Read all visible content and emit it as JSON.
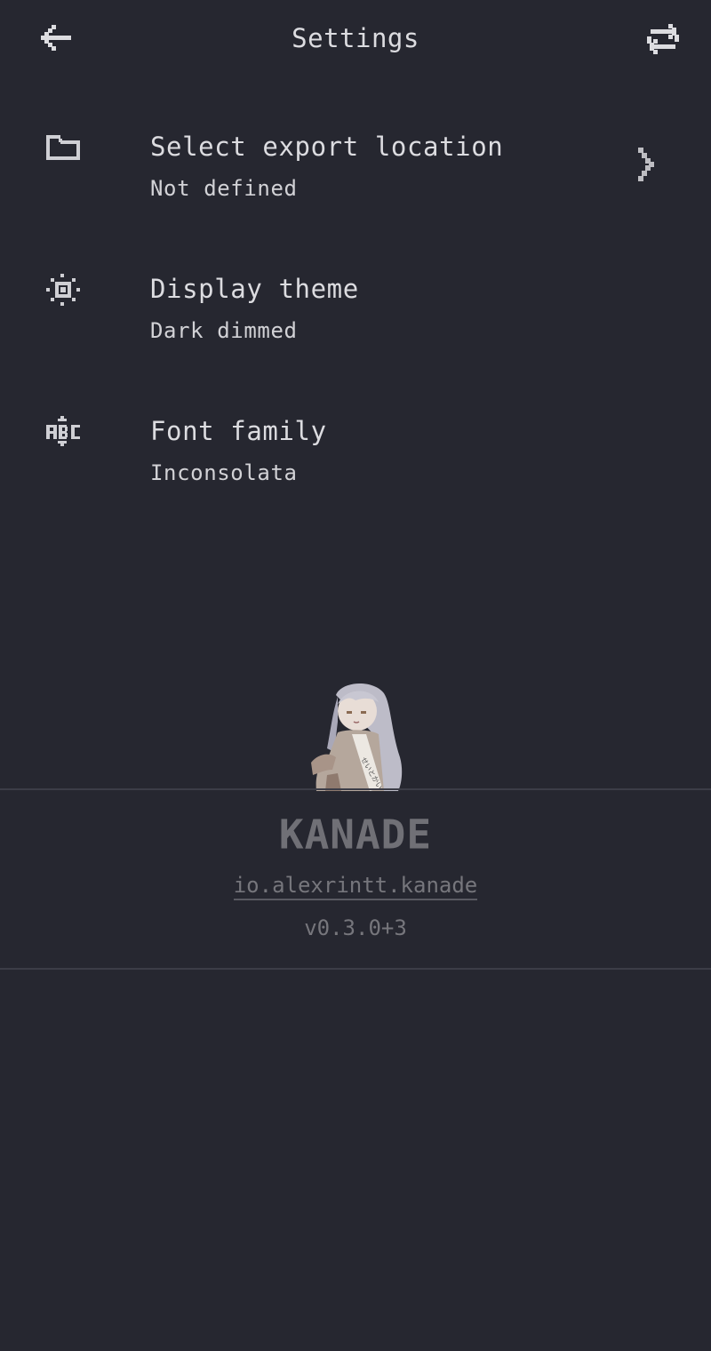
{
  "appbar": {
    "title": "Settings",
    "back_icon": "arrow-left-icon",
    "sync_icon": "repeat-icon"
  },
  "settings": [
    {
      "icon": "folder-icon",
      "title": "Select export location",
      "subtitle": "Not defined",
      "has_chevron": true
    },
    {
      "icon": "sun-icon",
      "title": "Display theme",
      "subtitle": "Dark dimmed"
    },
    {
      "icon": "abc-icon",
      "title": "Font family",
      "subtitle": "Inconsolata"
    }
  ],
  "footer": {
    "logo_text": "KANADE",
    "package_name": "io.alexrintt.kanade",
    "version": "v0.3.0+3"
  },
  "colors": {
    "background": "#262730",
    "text": "#dcdce0",
    "muted": "#76767c",
    "divider": "#3c3d47"
  }
}
